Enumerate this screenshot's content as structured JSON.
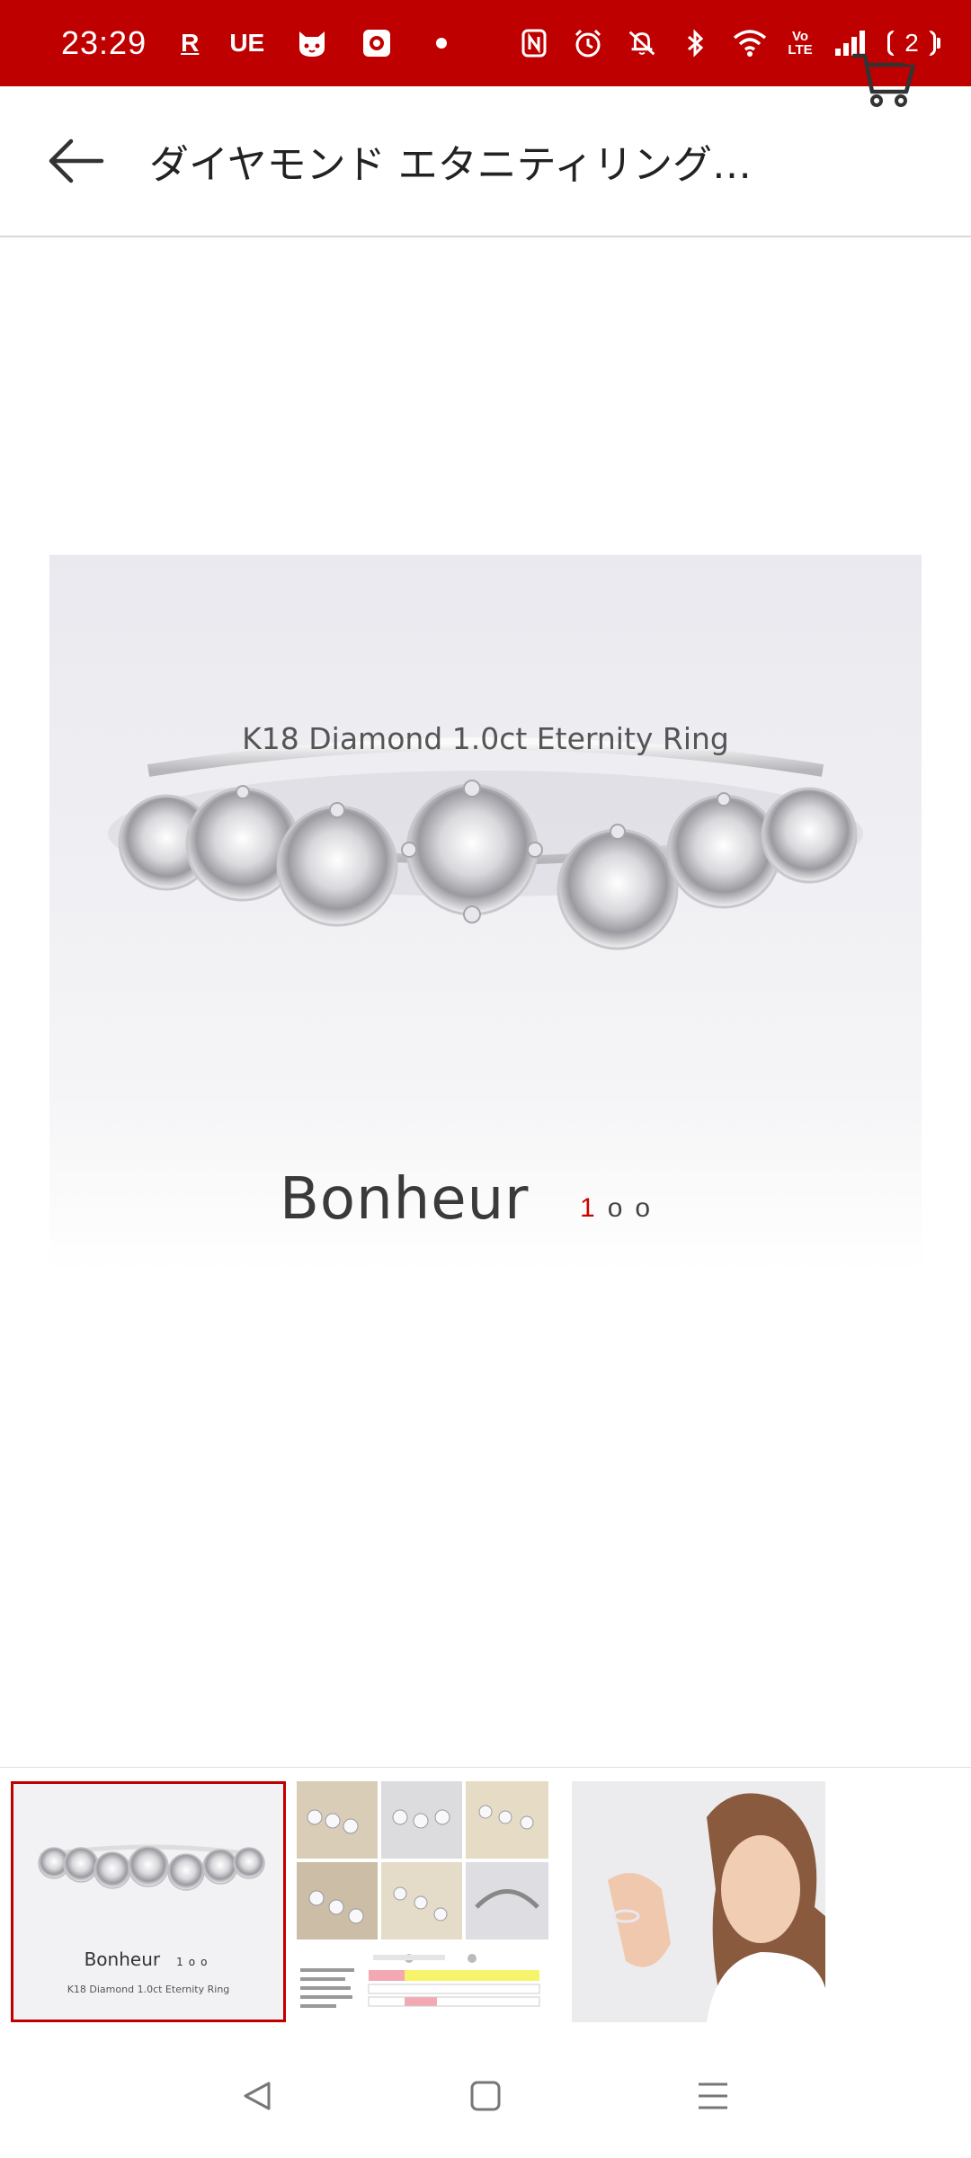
{
  "status_bar": {
    "time": "23:29",
    "left_glyphs": [
      "R",
      "UE"
    ],
    "battery": "97",
    "network_label": "Vo LTE",
    "background": "#bf0000"
  },
  "app_bar": {
    "title": "ダイヤモンド エタニティリング…",
    "back_icon": "arrow-left-icon",
    "cart_icon": "cart-icon",
    "cart_count": "2"
  },
  "product_image": {
    "brand": "Bonheur",
    "brand_mark": {
      "first": "1",
      "rest": "oo"
    },
    "tagline": "K18 Diamond 1.0ct Eternity Ring"
  },
  "thumbnails": [
    {
      "brand": "Bonheur",
      "brand_mark": "1oo",
      "tagline": "K18 Diamond 1.0ct Eternity Ring",
      "selected": true
    },
    {
      "selected": false
    },
    {
      "selected": false
    }
  ],
  "nav_bar": {
    "icons": [
      "back-triangle-icon",
      "home-square-icon",
      "menu-lines-icon"
    ]
  },
  "colors": {
    "accent": "#bf0000"
  }
}
